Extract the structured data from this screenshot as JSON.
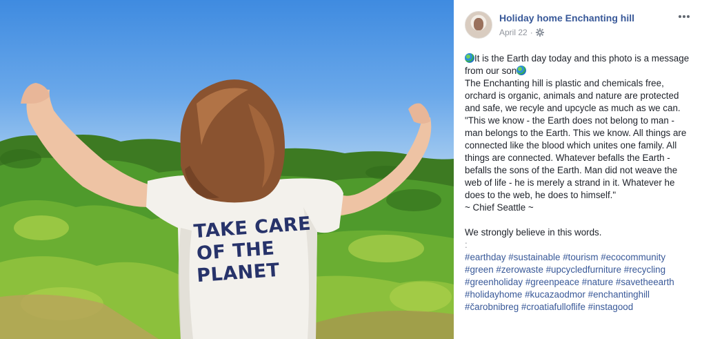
{
  "post": {
    "page_name": "Holiday home Enchanting hill",
    "date": "April 22",
    "separator": "·",
    "privacy_icon": "gear-icon",
    "more_icon": "more-options-icon",
    "body_lines": [
      "It is the Earth day today and this photo is a message from our son",
      "The Enchanting hill is plastic and chemicals free, orchard is organic, animals and nature are protected and safe, we recyle and upcycle as much as we can.",
      "\"This we know - the Earth does not belong to man - man belongs to the Earth. This we know. All things are connected like the blood which unites one family. All things are connected. Whatever befalls the Earth - befalls the sons of the Earth. Man did not weave the web of life - he is merely a strand in it. Whatever he does to the web, he does to himself.\"",
      "~ Chief Seattle ~"
    ],
    "belief_line": "We strongly believe in this words.",
    "colon_line": ":",
    "hashtag_lines": [
      "#earthday #sustainable #tourism #ecocommunity",
      "#green #zerowaste #upcycledfurniture #recycling",
      "#greenholiday #greenpeace #nature #savetheearth",
      "#holidayhome #kucazaodmor #enchantinghill",
      "#čarobnibreg #croatiafulloflife #instagood"
    ]
  },
  "photo": {
    "shirt_lines": [
      "TAKE CARE",
      "OF THE",
      "PLANET"
    ]
  },
  "colors": {
    "link": "#385898",
    "text": "#1d2129",
    "meta": "#90949c",
    "shirt_print": "#27336a"
  }
}
